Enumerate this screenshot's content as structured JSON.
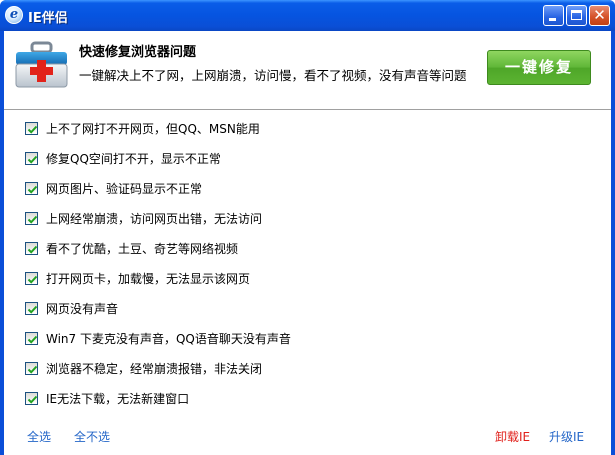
{
  "window": {
    "title": "IE伴侣",
    "icon": "ie-icon",
    "accent": "#0a4ed8"
  },
  "header": {
    "title": "快速修复浏览器问题",
    "description": "一键解决上不了网，上网崩溃，访问慢，看不了视频，没有声音等问题",
    "fix_button": "一键修复",
    "icon": "toolbox-icon"
  },
  "items": [
    {
      "label": "上不了网打不开网页，但QQ、MSN能用",
      "checked": true
    },
    {
      "label": "修复QQ空间打不开，显示不正常",
      "checked": true
    },
    {
      "label": "网页图片、验证码显示不正常",
      "checked": true
    },
    {
      "label": "上网经常崩溃，访问网页出错，无法访问",
      "checked": true
    },
    {
      "label": "看不了优酷，土豆、奇艺等网络视频",
      "checked": true
    },
    {
      "label": "打开网页卡，加载慢，无法显示该网页",
      "checked": true
    },
    {
      "label": "网页没有声音",
      "checked": true
    },
    {
      "label": "Win7 下麦克没有声音，QQ语音聊天没有声音",
      "checked": true
    },
    {
      "label": "浏览器不稳定，经常崩溃报错，非法关闭",
      "checked": true
    },
    {
      "label": "IE无法下载，无法新建窗口",
      "checked": true
    }
  ],
  "footer": {
    "select_all": "全选",
    "select_none": "全不选",
    "uninstall_ie": "卸载IE",
    "upgrade_ie": "升级IE"
  },
  "colors": {
    "link_blue": "#2466c8",
    "link_red": "#e0201b",
    "button_green": "#5cb432"
  }
}
